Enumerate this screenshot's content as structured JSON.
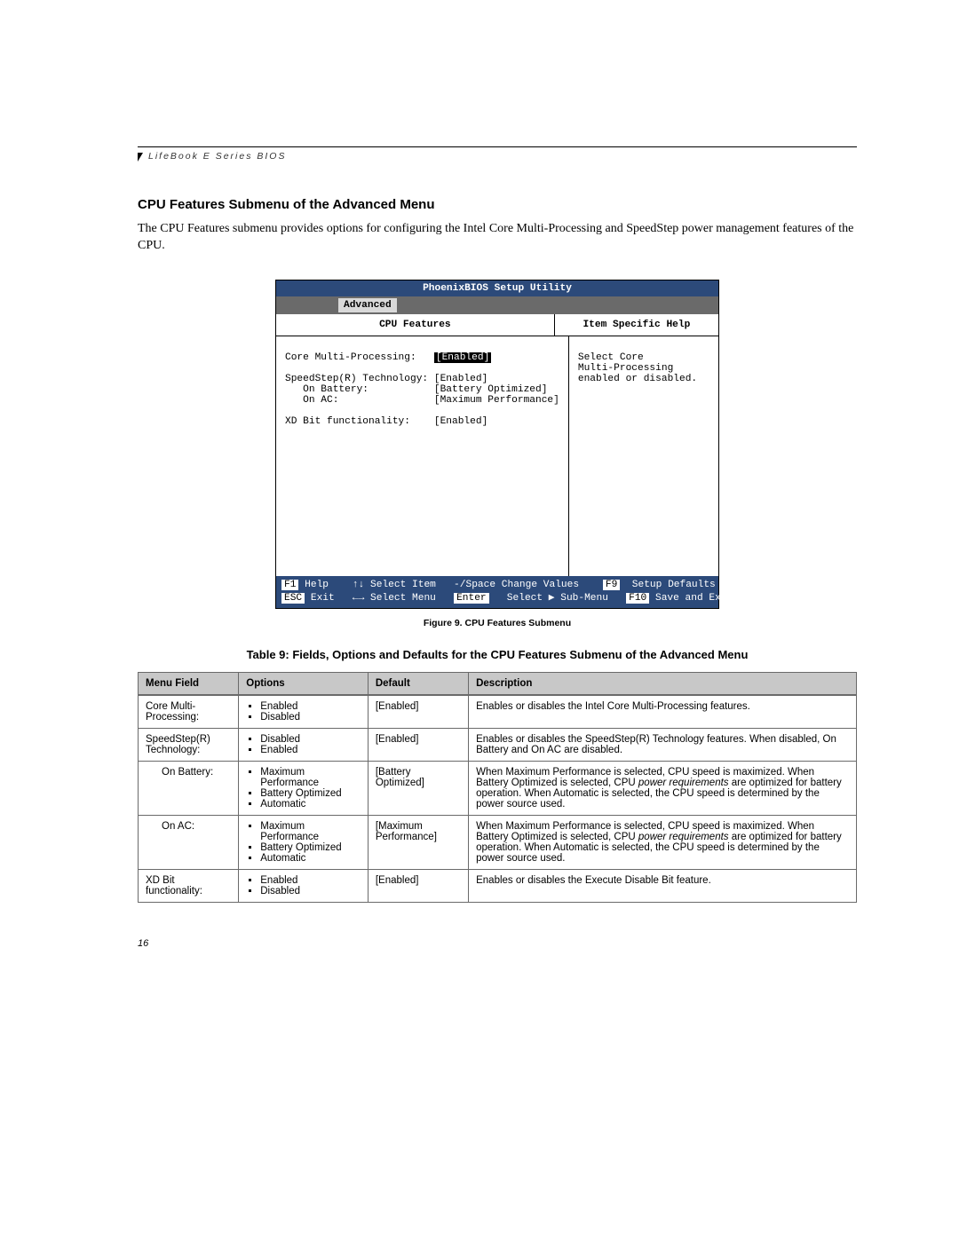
{
  "header": {
    "product_line": "LifeBook E Series BIOS"
  },
  "section": {
    "title": "CPU Features Submenu of the Advanced Menu",
    "body": "The CPU Features submenu provides options for configuring the Intel Core Multi-Processing and SpeedStep power management features of the CPU."
  },
  "bios": {
    "titlebar": "PhoenixBIOS Setup Utility",
    "tab": "Advanced",
    "left_title": "CPU Features",
    "right_title": "Item Specific Help",
    "settings": {
      "row1_label": "Core Multi-Processing:",
      "row1_value": "[Enabled]",
      "row2_label": "SpeedStep(R) Technology:",
      "row2_value": "[Enabled]",
      "row3_label": "   On Battery:",
      "row3_value": "[Battery Optimized]",
      "row4_label": "   On AC:",
      "row4_value": "[Maximum Performance]",
      "row5_label": "XD Bit functionality:",
      "row5_value": "[Enabled]"
    },
    "help_text": "Select Core\nMulti-Processing\nenabled or disabled.",
    "footer": {
      "f1": "F1",
      "f1_label": "Help",
      "arrows_ud": "↑↓",
      "select_item": "Select Item",
      "minus_space": "-/Space",
      "change_values": "Change Values",
      "f9": "F9",
      "setup_defaults": "Setup Defaults",
      "esc": "ESC",
      "exit": "Exit",
      "arrows_lr": "←→",
      "select_menu": "Select Menu",
      "enter": "Enter",
      "select_sub": "Select ▶ Sub-Menu",
      "f10": "F10",
      "save_exit": "Save and Exit"
    }
  },
  "figure_caption": "Figure 9.  CPU Features Submenu",
  "table_title": "Table 9: Fields, Options and Defaults for the CPU Features Submenu of the Advanced Menu",
  "table": {
    "headers": [
      "Menu Field",
      "Options",
      "Default",
      "Description"
    ],
    "rows": [
      {
        "menu": "Core Multi-Processing:",
        "options": [
          "Enabled",
          "Disabled"
        ],
        "default": "[Enabled]",
        "desc": "Enables or disables the Intel Core Multi-Processing features."
      },
      {
        "menu": "SpeedStep(R) Technology:",
        "options": [
          "Disabled",
          "Enabled"
        ],
        "default": "[Enabled]",
        "desc": "Enables or disables the SpeedStep(R) Technology features. When disabled, On Battery and On AC are disabled."
      },
      {
        "menu": "On Battery:",
        "indent": true,
        "options": [
          "Maximum Performance",
          "Battery Optimized",
          "Automatic"
        ],
        "default": "[Battery Optimized]",
        "desc_html": "When Maximum Performance is selected, CPU speed is maximized. When Battery Optimized is selected, CPU <em>power requirements</em> are optimized for battery operation. When Automatic is selected, the CPU speed is determined by the power source used."
      },
      {
        "menu": "On AC:",
        "indent": true,
        "options": [
          "Maximum Performance",
          "Battery Optimized",
          "Automatic"
        ],
        "default": "[Maximum Performance]",
        "desc_html": "When Maximum Performance is selected, CPU speed is maximized. When Battery Optimized is selected, CPU <em>power requirements</em> are optimized for battery operation. When Automatic is selected, the CPU speed is determined by the power source used."
      },
      {
        "menu": "XD Bit functionality:",
        "options": [
          "Enabled",
          "Disabled"
        ],
        "default": "[Enabled]",
        "desc": "Enables or disables the Execute Disable Bit feature."
      }
    ]
  },
  "page_number": "16"
}
